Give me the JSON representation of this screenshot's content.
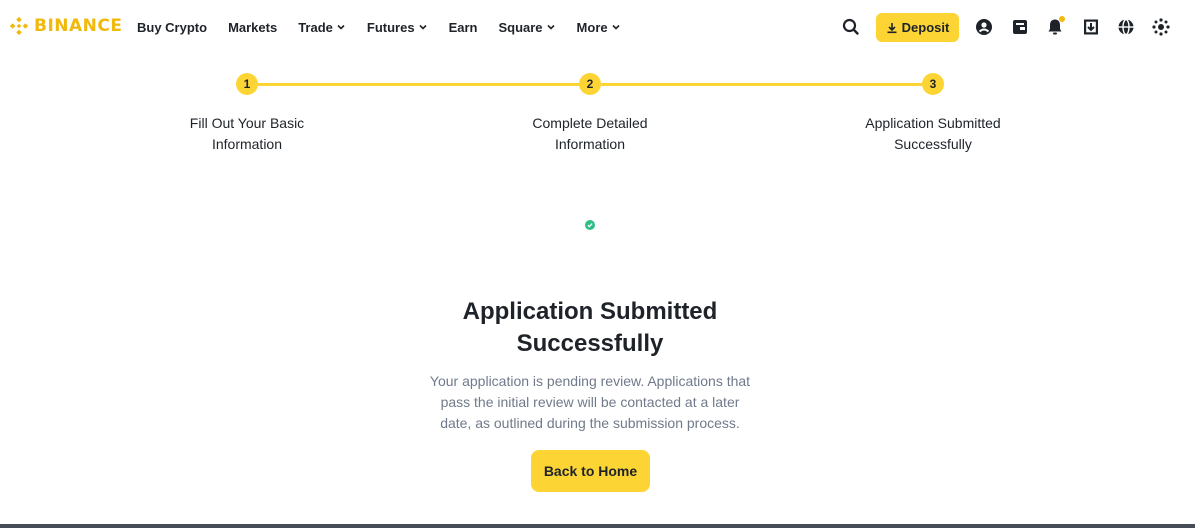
{
  "brand": {
    "name": "BINANCE",
    "color": "#f0b90b"
  },
  "nav": {
    "items": [
      {
        "label": "Buy Crypto",
        "dropdown": false
      },
      {
        "label": "Markets",
        "dropdown": false
      },
      {
        "label": "Trade",
        "dropdown": true
      },
      {
        "label": "Futures",
        "dropdown": true
      },
      {
        "label": "Earn",
        "dropdown": false
      },
      {
        "label": "Square",
        "dropdown": true
      },
      {
        "label": "More",
        "dropdown": true
      }
    ]
  },
  "header_actions": {
    "deposit_label": "Deposit",
    "icons": [
      "search-icon",
      "download-icon",
      "user-icon",
      "wallet-icon",
      "bell-icon",
      "app-download-icon",
      "globe-icon",
      "settings-icon"
    ]
  },
  "stepper": {
    "steps": [
      {
        "number": "1",
        "label_line1": "Fill Out Your Basic",
        "label_line2": "Information"
      },
      {
        "number": "2",
        "label_line1": "Complete Detailed",
        "label_line2": "Information"
      },
      {
        "number": "3",
        "label_line1": "Application Submitted",
        "label_line2": "Successfully"
      }
    ],
    "current_step": 3
  },
  "result": {
    "icon": "check-circle-icon",
    "title_line1": "Application Submitted",
    "title_line2": "Successfully",
    "desc_line1": "Your application is pending review. Applications that",
    "desc_line2": "pass the initial review will be contacted at a later",
    "desc_line3": "date, as outlined during the submission process.",
    "button_label": "Back to Home"
  },
  "colors": {
    "accent": "#fcd535",
    "text_primary": "#1e2329",
    "text_secondary": "#707a8a",
    "success": "#2ebd85"
  }
}
